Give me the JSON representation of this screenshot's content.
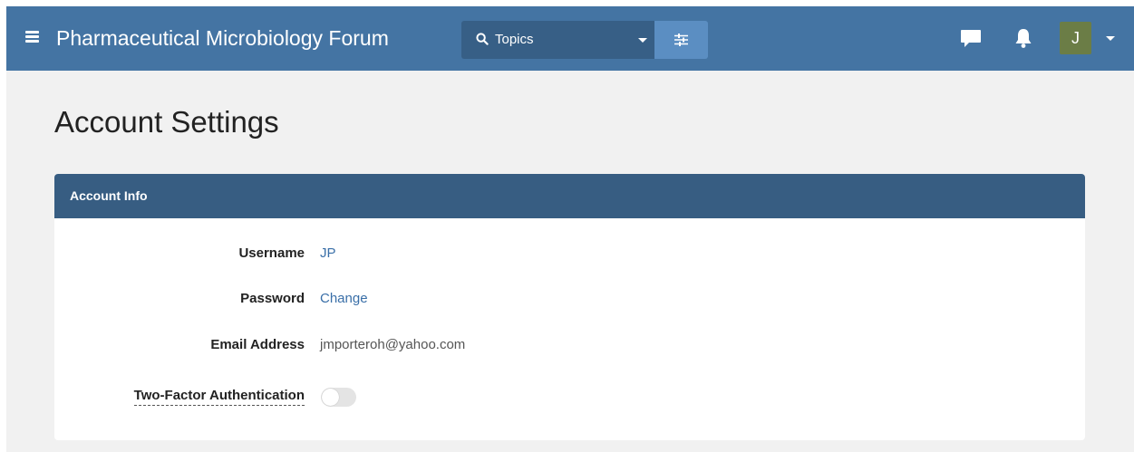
{
  "header": {
    "site_title": "Pharmaceutical Microbiology Forum",
    "search": {
      "scope_label": "Topics",
      "icon": "search-icon"
    },
    "filter_icon": "filter-sliders-icon",
    "chat_icon": "chat-bubble-icon",
    "bell_icon": "bell-icon",
    "avatar_initial": "J",
    "colors": {
      "bar": "#4474a3",
      "search_bg": "#375f86",
      "filter_bg": "#5b8ec2",
      "avatar_bg": "#6b7d46"
    }
  },
  "page": {
    "title": "Account Settings"
  },
  "account_info": {
    "panel_title": "Account Info",
    "header_color": "#375d82",
    "rows": [
      {
        "label": "Username",
        "value": "JP"
      },
      {
        "label": "Password",
        "value": "Change"
      },
      {
        "label": "Email Address",
        "value": "jmporteroh@yahoo.com"
      },
      {
        "label": "Two-Factor Authentication",
        "enabled": false
      }
    ]
  }
}
